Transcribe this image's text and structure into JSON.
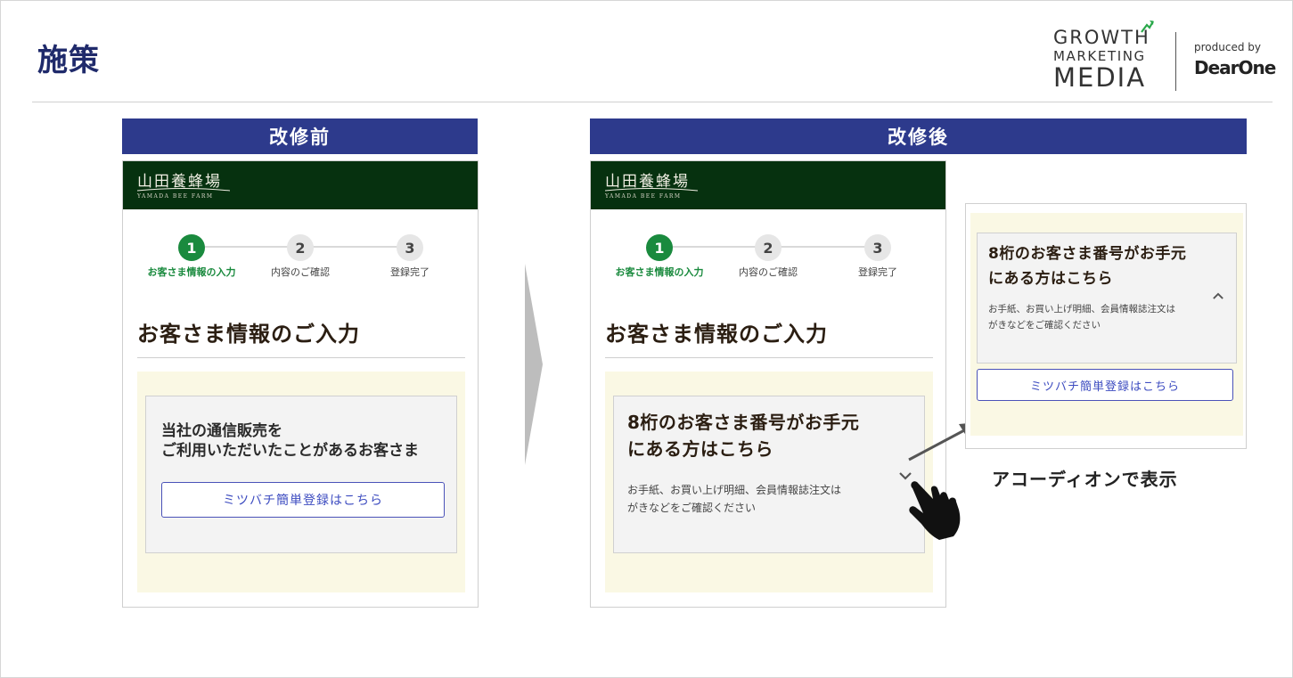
{
  "slide": {
    "title": "施策"
  },
  "logo": {
    "line1": "GROWTH",
    "line2": "MARKETING",
    "line3": "MEDIA",
    "produced_by": "produced by",
    "dearone": "DearOne",
    "accent": "#2aa84a"
  },
  "columns": [
    {
      "label": "改修前"
    },
    {
      "label": "改修後"
    }
  ],
  "shop": {
    "name": "山田養蜂場",
    "sub": "YAMADA BEE FARM",
    "bar_color": "#06310f"
  },
  "steps": [
    {
      "num": "1",
      "label": "お客さま情報の入力",
      "active": true
    },
    {
      "num": "2",
      "label": "内容のご確認",
      "active": false
    },
    {
      "num": "3",
      "label": "登録完了",
      "active": false
    }
  ],
  "page_heading": "お客さま情報のご入力",
  "before": {
    "box_text_1": "当社の通信販売を",
    "box_text_2": "ご利用いただいたことがあるお客さま",
    "button_label": "ミツバチ簡単登録はこちら"
  },
  "after": {
    "accordion_title_1": "8桁のお客さま番号がお手元",
    "accordion_title_2": "にある方はこちら",
    "desc_1": "お手紙、お買い上げ明細、会員情報誌注文は",
    "desc_2": "がきなどをご確認ください",
    "chevron": "chevron-down-icon"
  },
  "expanded": {
    "accordion_title_1": "8桁のお客さま番号がお手元",
    "accordion_title_2": "にある方はこちら",
    "desc_1": "お手紙、お買い上げ明細、会員情報誌注文は",
    "desc_2": "がきなどをご確認ください",
    "button_label": "ミツバチ簡単登録はこちら",
    "chevron": "chevron-up-icon"
  },
  "caption": "アコーディオンで表示",
  "colors": {
    "header_bg": "#2d3a8c",
    "active_green": "#1a8a3e",
    "cream": "#faf8e4",
    "button_blue": "#3d4cc0"
  }
}
